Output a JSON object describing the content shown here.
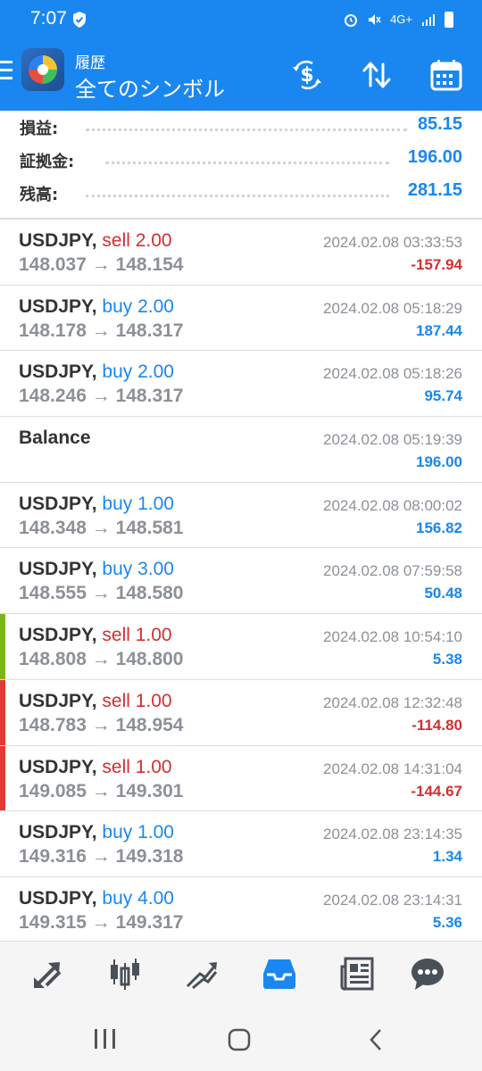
{
  "status": {
    "time": "7:07",
    "network": "4G+"
  },
  "header": {
    "subtitle": "履歴",
    "title": "全てのシンボル"
  },
  "summary": [
    {
      "label": "損益:",
      "value": "85.15"
    },
    {
      "label": "証拠金:",
      "value": "196.00"
    },
    {
      "label": "残高:",
      "value": "281.15"
    }
  ],
  "deals": [
    {
      "symbol": "USDJPY,",
      "side": "sell 2.00",
      "side_type": "sell",
      "prices": "148.037 → 148.154",
      "time": "2024.02.08 03:33:53",
      "profit": "-157.94",
      "profit_sign": "neg",
      "marker": ""
    },
    {
      "symbol": "USDJPY,",
      "side": "buy 2.00",
      "side_type": "buy",
      "prices": "148.178 → 148.317",
      "time": "2024.02.08 05:18:29",
      "profit": "187.44",
      "profit_sign": "pos",
      "marker": ""
    },
    {
      "symbol": "USDJPY,",
      "side": "buy 2.00",
      "side_type": "buy",
      "prices": "148.246 → 148.317",
      "time": "2024.02.08 05:18:26",
      "profit": "95.74",
      "profit_sign": "pos",
      "marker": ""
    },
    {
      "symbol": "Balance",
      "side": "",
      "side_type": "",
      "prices": "",
      "time": "2024.02.08 05:19:39",
      "profit": "196.00",
      "profit_sign": "pos",
      "marker": ""
    },
    {
      "symbol": "USDJPY,",
      "side": "buy 1.00",
      "side_type": "buy",
      "prices": "148.348 → 148.581",
      "time": "2024.02.08 08:00:02",
      "profit": "156.82",
      "profit_sign": "pos",
      "marker": ""
    },
    {
      "symbol": "USDJPY,",
      "side": "buy 3.00",
      "side_type": "buy",
      "prices": "148.555 → 148.580",
      "time": "2024.02.08 07:59:58",
      "profit": "50.48",
      "profit_sign": "pos",
      "marker": ""
    },
    {
      "symbol": "USDJPY,",
      "side": "sell 1.00",
      "side_type": "sell",
      "prices": "148.808 → 148.800",
      "time": "2024.02.08 10:54:10",
      "profit": "5.38",
      "profit_sign": "pos",
      "marker": "#7cb518"
    },
    {
      "symbol": "USDJPY,",
      "side": "sell 1.00",
      "side_type": "sell",
      "prices": "148.783 → 148.954",
      "time": "2024.02.08 12:32:48",
      "profit": "-114.80",
      "profit_sign": "neg",
      "marker": "#e53935"
    },
    {
      "symbol": "USDJPY,",
      "side": "sell 1.00",
      "side_type": "sell",
      "prices": "149.085 → 149.301",
      "time": "2024.02.08 14:31:04",
      "profit": "-144.67",
      "profit_sign": "neg",
      "marker": "#e53935"
    },
    {
      "symbol": "USDJPY,",
      "side": "buy 1.00",
      "side_type": "buy",
      "prices": "149.316 → 149.318",
      "time": "2024.02.08 23:14:35",
      "profit": "1.34",
      "profit_sign": "pos",
      "marker": ""
    },
    {
      "symbol": "USDJPY,",
      "side": "buy 4.00",
      "side_type": "buy",
      "prices": "149.315 → 149.317",
      "time": "2024.02.08 23:14:31",
      "profit": "5.36",
      "profit_sign": "pos",
      "marker": ""
    }
  ],
  "nav": [
    {
      "icon": "quotes-icon",
      "active": false
    },
    {
      "icon": "chart-candles-icon",
      "active": false
    },
    {
      "icon": "trade-icon",
      "active": false
    },
    {
      "icon": "history-inbox-icon",
      "active": true
    },
    {
      "icon": "news-icon",
      "active": false
    },
    {
      "icon": "chat-icon",
      "active": false
    }
  ],
  "colors": {
    "accent": "#1a87f0",
    "sell": "#d32f2f",
    "nav_inactive": "#4a5058"
  }
}
